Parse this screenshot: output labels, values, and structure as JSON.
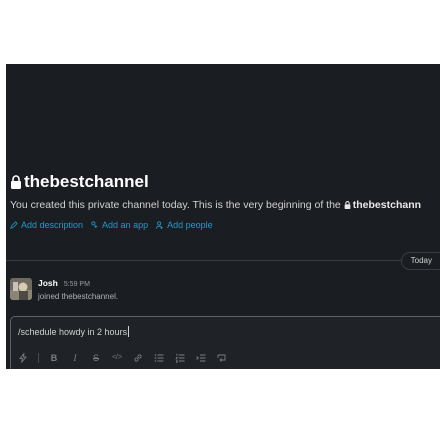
{
  "channel": {
    "name": "thebestchannel",
    "intro_text": "You created this private channel today. This is the very beginning of the",
    "intro_channel": "thebestchann"
  },
  "actions": [
    {
      "label": "Add description",
      "icon": "pencil-icon"
    },
    {
      "label": "Add an app",
      "icon": "app-icon"
    },
    {
      "label": "Add people",
      "icon": "add-person-icon"
    }
  ],
  "divider": {
    "date_label": "Today"
  },
  "message": {
    "author": "Josh",
    "time": "5:59 PM",
    "text": "joined thebestchannel."
  },
  "composer": {
    "value": "/schedule howdy in 2 hours",
    "toolbar": {
      "bold": "B",
      "italic": "I",
      "strike": "S",
      "code": "</>"
    }
  },
  "colors": {
    "background": "#1a1d21",
    "link": "#1d9bd1",
    "text": "#d1d2d3"
  }
}
